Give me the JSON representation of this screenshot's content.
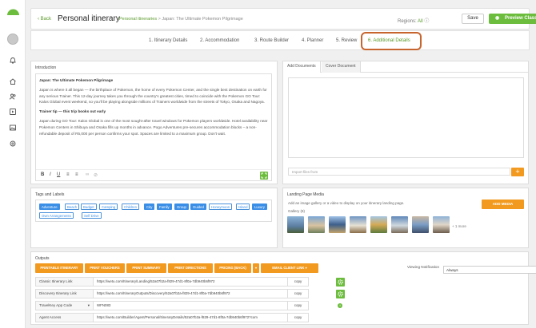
{
  "colors": {
    "accent_green": "#6cbc3d",
    "orange": "#f29a1f",
    "tag_blue": "#3a8ee6",
    "highlight": "#c7652e"
  },
  "header": {
    "back_label": "Back",
    "title": "Personal itinerary",
    "crumb_1": "Personal itineraries",
    "crumb_sep": ">",
    "crumb_2": "Japan: The Ultimate Pokemon Pilgrimage",
    "regions_label": "Regions:",
    "regions_value": "All",
    "save_label": "Save",
    "preview_label": "Preview Classic"
  },
  "tabs": [
    {
      "label": "1. Itinerary Details"
    },
    {
      "label": "2. Accommodation"
    },
    {
      "label": "3. Route Builder"
    },
    {
      "label": "4. Planner"
    },
    {
      "label": "5. Review"
    },
    {
      "label": "6. Additional Details"
    }
  ],
  "introduction": {
    "title": "Introduction",
    "heading": "Japan: The Ultimate Pokemon Pilgrimage",
    "p1": "Japan is where it all began — the birthplace of Pokemon, the home of every Pokemon Center, and the single best destination on earth for any serious Trainer. This 12-day journey takes you through the country's greatest cities, timed to coincide with the Pokemon GO Tour: Kalos Global event weekend, so you'll be playing alongside millions of Trainers worldwide from the streets of Tokyo, Osaka and Nagoya.",
    "tip_heading": "Trainer tip — this trip books out early",
    "p2": "Japan during GO Tour: Kalos Global is one of the most sought-after travel windows for Pokemon players worldwide. Hotel availability near Pokemon Centers in Shibuya and Osaka fills up months in advance. Pogo Adventures pre-secures accommodation blocks – a non-refundable deposit of R5,000 per person confirms your spot. Spaces are limited to a maximum group. Don't wait."
  },
  "tags": {
    "title": "Tags and Labels",
    "items": [
      {
        "label": "Adventure",
        "on": true
      },
      {
        "label": "Beach",
        "on": false
      },
      {
        "label": "Budget",
        "on": false
      },
      {
        "label": "Camping",
        "on": false
      },
      {
        "label": "Children",
        "on": false
      },
      {
        "label": "City",
        "on": true
      },
      {
        "label": "Family",
        "on": true
      },
      {
        "label": "Group",
        "on": true
      },
      {
        "label": "Guided",
        "on": true
      },
      {
        "label": "Honeymoon",
        "on": false
      },
      {
        "label": "Island",
        "on": false
      },
      {
        "label": "Luxury",
        "on": true
      },
      {
        "label": "Own Arrangements",
        "on": false
      },
      {
        "label": "Self Drive",
        "on": false
      }
    ]
  },
  "documents": {
    "tab_add": "Add Documents",
    "tab_cover": "Cover Document",
    "import_placeholder": "Import files from"
  },
  "landing": {
    "title": "Landing Page Media",
    "desc": "Add an image gallery or a video to display on your itinerary landing page.",
    "gallery_label": "Gallery (8)",
    "add_media_label": "ADD MEDIA",
    "more_label": "+ 1 more"
  },
  "outputs": {
    "title": "Outputs",
    "buttons": [
      "PRINTABLE ITINERARY",
      "PRINT VOUCHERS",
      "PRINT SUMMARY",
      "PRINT DIRECTIONS",
      "PRICING (BACK)",
      "EMAIL CLIENT LINK"
    ],
    "rows": [
      {
        "label": "Classic Itinerary Link",
        "url": "https://wetu.com/Itinerary/Landing/52a07b2a-f829-47d1-8f0a-7db940b6f972",
        "copy": "copy"
      },
      {
        "label": "Discovery Itinerary Link",
        "url": "https://wetu.com/ItineraryOutputs/Discovery/52a07b2a-f829-47d1-8f0a-7db940b6f972",
        "copy": "copy"
      },
      {
        "label": "TravelKey App Code",
        "url": "WFN083",
        "copy": "copy"
      },
      {
        "label": "Agent Access",
        "url": "https://wetu.com/Builder/Agent/Personal/ItineraryDetails/52a07b2a-f829-47d1-8f0a-7db940b6f972?com",
        "copy": "copy"
      }
    ],
    "viewing_label": "Viewing Notification",
    "viewing_value": "Always"
  }
}
